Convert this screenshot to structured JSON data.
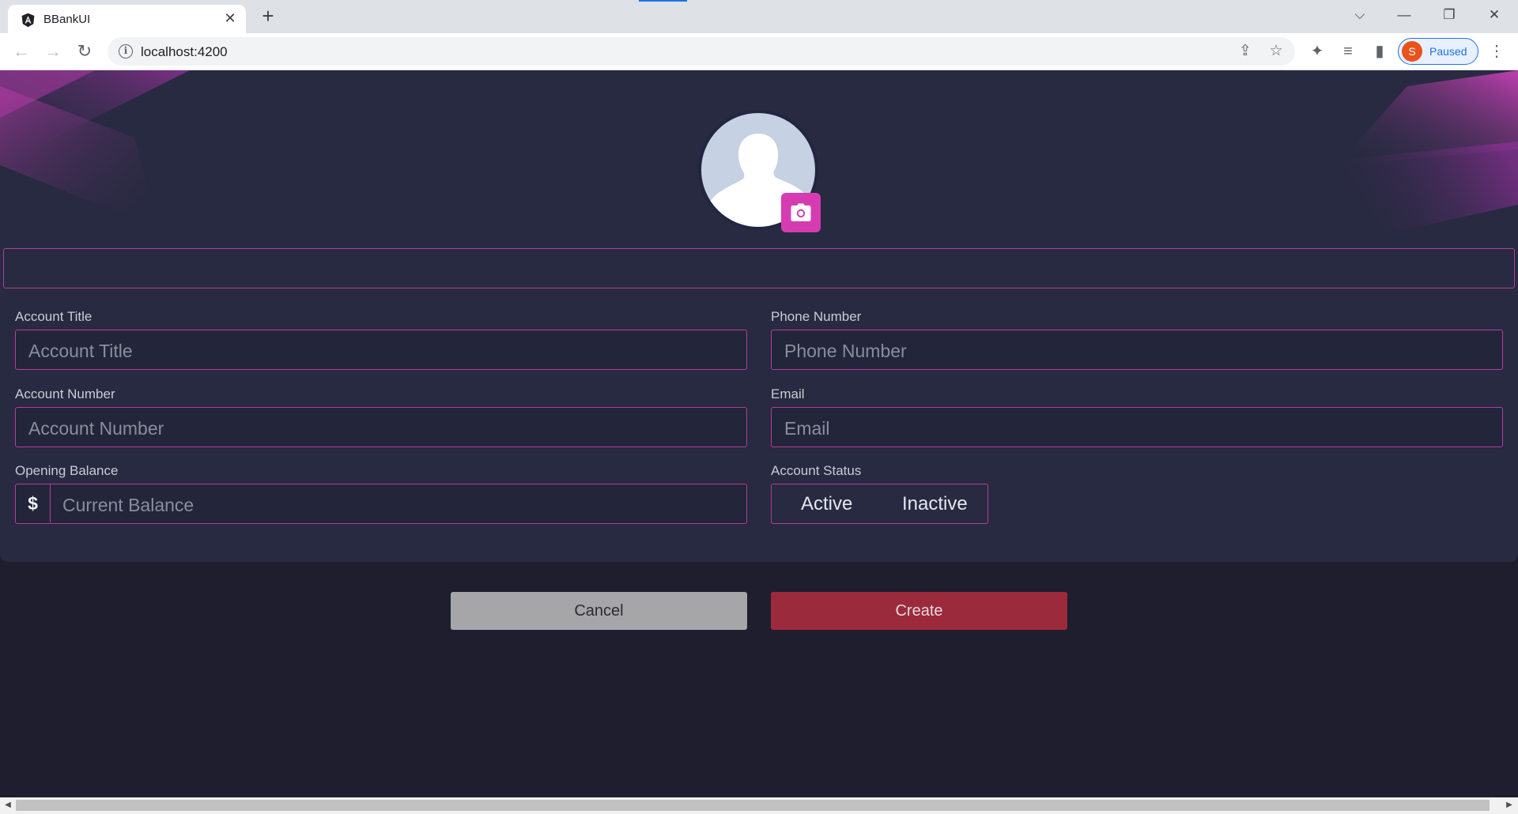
{
  "browser": {
    "tab_title": "BBankUI",
    "tab_close": "✕",
    "new_tab": "+",
    "url": "localhost:4200",
    "profile_initial": "S",
    "profile_status": "Paused",
    "window_controls": [
      "⌵",
      "—",
      "❐",
      "✕"
    ]
  },
  "form": {
    "fields": {
      "account_title": {
        "label": "Account Title",
        "placeholder": "Account Title"
      },
      "phone_number": {
        "label": "Phone Number",
        "placeholder": "Phone Number"
      },
      "account_number": {
        "label": "Account Number",
        "placeholder": "Account Number"
      },
      "email": {
        "label": "Email",
        "placeholder": "Email"
      },
      "opening_balance": {
        "label": "Opening Balance",
        "prefix": "$",
        "placeholder": "Current Balance"
      },
      "account_status": {
        "label": "Account Status",
        "options": [
          "Active",
          "Inactive"
        ]
      }
    },
    "buttons": {
      "cancel": "Cancel",
      "create": "Create"
    }
  },
  "colors": {
    "accent": "#d63cb1",
    "field_border": "#b63c9c",
    "card_bg": "#272a40",
    "page_bg": "#1f1e2e",
    "create_button": "#9b2a3d",
    "cancel_button": "#a6a6a8"
  },
  "icons": {
    "tab_favicon": "angular-logo-icon",
    "avatar": "user-silhouette-icon",
    "upload_photo": "camera-icon"
  }
}
